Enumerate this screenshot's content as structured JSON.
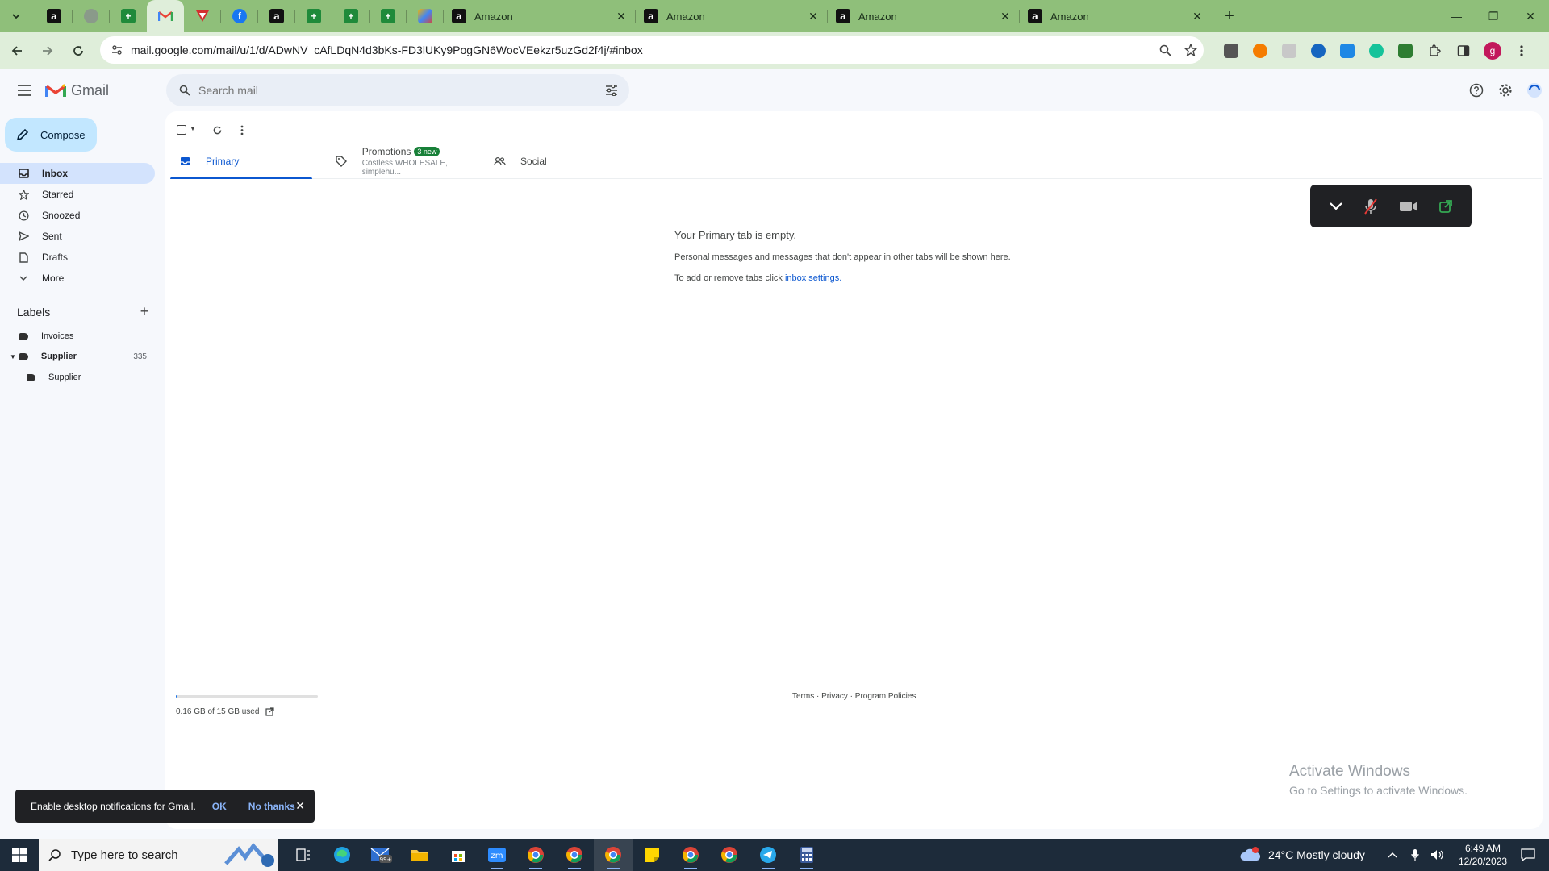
{
  "browser": {
    "pinned_tabs": [
      {
        "icon": "amazon-favicon",
        "glyph": "a"
      },
      {
        "icon": "globe-favicon",
        "glyph": ""
      },
      {
        "icon": "sheets-favicon",
        "glyph": "+"
      },
      {
        "icon": "gmail-favicon",
        "glyph": "M"
      },
      {
        "icon": "red-favicon",
        "glyph": "▽"
      },
      {
        "icon": "facebook-favicon",
        "glyph": "f"
      },
      {
        "icon": "amazon-favicon",
        "glyph": "a"
      },
      {
        "icon": "sheets-favicon",
        "glyph": "+"
      },
      {
        "icon": "sheets-favicon",
        "glyph": "+"
      },
      {
        "icon": "sheets-favicon",
        "glyph": "+"
      },
      {
        "icon": "multicolor-favicon",
        "glyph": ""
      }
    ],
    "tabs": [
      {
        "title": "Amazon"
      },
      {
        "title": "Amazon"
      },
      {
        "title": "Amazon"
      },
      {
        "title": "Amazon"
      }
    ],
    "url": "mail.google.com/mail/u/1/d/ADwNV_cAfLDqN4d3bKs-FD3lUKy9PogGN6WocVEekzr5uzGd2f4j/#inbox",
    "profile_initial": "g"
  },
  "gmail": {
    "logo_text": "Gmail",
    "search_placeholder": "Search mail",
    "compose_label": "Compose",
    "nav": [
      {
        "label": "Inbox",
        "icon": "inbox-icon",
        "active": true
      },
      {
        "label": "Starred",
        "icon": "star-icon"
      },
      {
        "label": "Snoozed",
        "icon": "clock-icon"
      },
      {
        "label": "Sent",
        "icon": "send-icon"
      },
      {
        "label": "Drafts",
        "icon": "draft-icon"
      },
      {
        "label": "More",
        "icon": "chevron-down-icon"
      }
    ],
    "labels_title": "Labels",
    "labels": [
      {
        "name": "Invoices",
        "count": ""
      },
      {
        "name": "Supplier",
        "count": "335"
      },
      {
        "name": "Supplier",
        "count": ""
      }
    ],
    "inbox_tabs": {
      "primary": "Primary",
      "promotions": "Promotions",
      "promotions_badge": "3 new",
      "promotions_sub": "Costless WHOLESALE, simplehu...",
      "social": "Social"
    },
    "empty": {
      "heading": "Your Primary tab is empty.",
      "line1": "Personal messages and messages that don't appear in other tabs will be shown here.",
      "line2_prefix": "To add or remove tabs click ",
      "line2_link": "inbox settings",
      "line2_suffix": "."
    },
    "storage": {
      "text": "0.16 GB of 15 GB used",
      "used_fraction": 0.011
    },
    "footer": "Terms · Privacy · Program Policies",
    "snackbar": {
      "message": "Enable desktop notifications for Gmail.",
      "ok": "OK",
      "no": "No thanks"
    }
  },
  "os": {
    "activate_title": "Activate Windows",
    "activate_sub": "Go to Settings to activate Windows.",
    "search_placeholder": "Type here to search",
    "weather": "24°C  Mostly cloudy",
    "time": "6:49 AM",
    "date": "12/20/2023",
    "mail_badge": "99+"
  },
  "colors": {
    "accent": "#0b57d0",
    "compose": "#c2e7ff",
    "tabstrip": "#8fbf7a",
    "toolbar": "#dfeeda"
  }
}
